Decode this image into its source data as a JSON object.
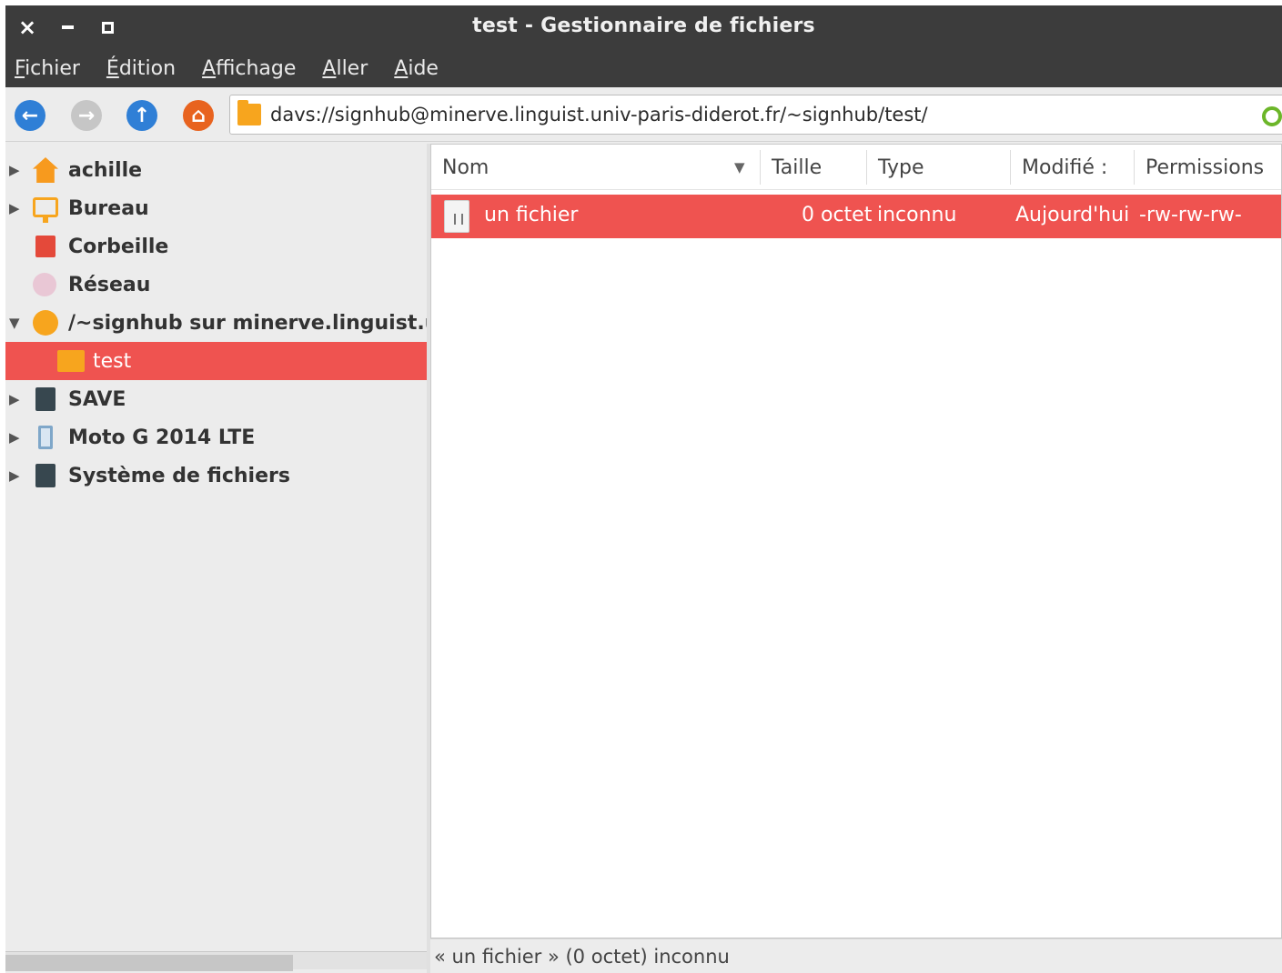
{
  "window": {
    "title": "test - Gestionnaire de fichiers",
    "controls": {
      "close": "×"
    }
  },
  "menu": [
    "Fichier",
    "Édition",
    "Affichage",
    "Aller",
    "Aide"
  ],
  "toolbar": {
    "back_icon": "arrow-left-icon",
    "forward_icon": "arrow-right-icon",
    "up_icon": "arrow-up-icon",
    "home_icon": "home-icon",
    "address": "davs://signhub@minerve.linguist.univ-paris-diderot.fr/~signhub/test/"
  },
  "sidebar": {
    "items": [
      {
        "label": "achille",
        "expander": "▶",
        "icon": "home-icon"
      },
      {
        "label": "Bureau",
        "expander": "▶",
        "icon": "desktop-icon"
      },
      {
        "label": "Corbeille",
        "expander": "",
        "icon": "trash-icon"
      },
      {
        "label": "Réseau",
        "expander": "",
        "icon": "network-icon"
      },
      {
        "label": "/~signhub sur minerve.linguist.univ",
        "expander": "▼",
        "icon": "remote-share-icon"
      },
      {
        "label": "test",
        "expander": "",
        "icon": "folder-icon",
        "selected": true
      },
      {
        "label": "SAVE",
        "expander": "▶",
        "icon": "drive-icon"
      },
      {
        "label": "Moto G 2014 LTE",
        "expander": "▶",
        "icon": "phone-icon"
      },
      {
        "label": "Système de fichiers",
        "expander": "▶",
        "icon": "drive-icon"
      }
    ]
  },
  "filelist": {
    "columns": [
      "Nom",
      "Taille",
      "Type",
      "Modifié :",
      "Permissions"
    ],
    "sort_indicator": "▼",
    "rows": [
      {
        "name": "un fichier",
        "size": "0 octet",
        "type": "inconnu",
        "modified": "Aujourd'hui",
        "permissions": "-rw-rw-rw-",
        "selected": true
      }
    ]
  },
  "status": "« un fichier » (0 octet) inconnu",
  "colors": {
    "selection": "#ef5350",
    "titlebar": "#3c3c3c",
    "folder": "#f7a51e",
    "accent_blue": "#2f7fd6"
  }
}
